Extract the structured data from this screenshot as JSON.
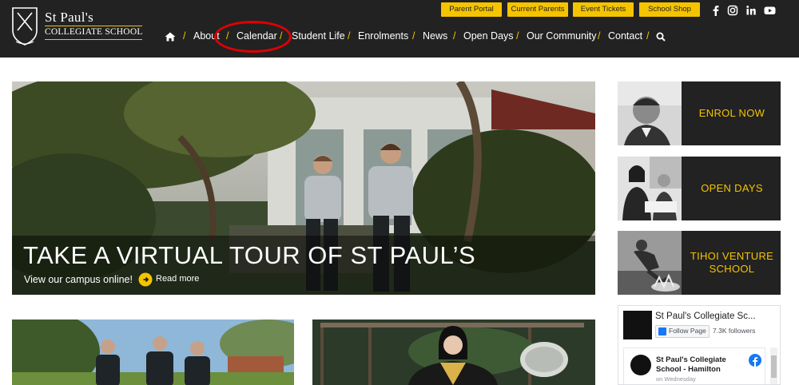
{
  "site": {
    "name": "St Paul's",
    "subtitle": "COLLEGIATE SCHOOL"
  },
  "top_links": [
    "Parent Portal",
    "Current Parents",
    "Event Tickets",
    "School Shop"
  ],
  "social_icons": [
    "facebook-icon",
    "instagram-icon",
    "linkedin-icon",
    "youtube-icon"
  ],
  "nav": {
    "items": [
      "About",
      "Calendar",
      "Student Life",
      "Enrolments",
      "News",
      "Open Days",
      "Our Community",
      "Contact"
    ],
    "separator": "/"
  },
  "hero": {
    "title": "TAKE A VIRTUAL TOUR OF ST PAUL’S",
    "subtitle": "View our campus online!",
    "read_more": "Read more"
  },
  "promo_tiles": [
    "ENROL NOW",
    "OPEN DAYS",
    "TIHOI VENTURE SCHOOL"
  ],
  "facebook": {
    "page_name": "St Paul's Collegiate Sc...",
    "follow_label": "Follow Page",
    "followers": "7.3K followers",
    "post_author": "St Paul's Collegiate School - Hamilton",
    "post_time": "on Wednesday"
  },
  "colors": {
    "header_bg": "#222222",
    "accent": "#f5c400",
    "annotation": "#e00000"
  }
}
